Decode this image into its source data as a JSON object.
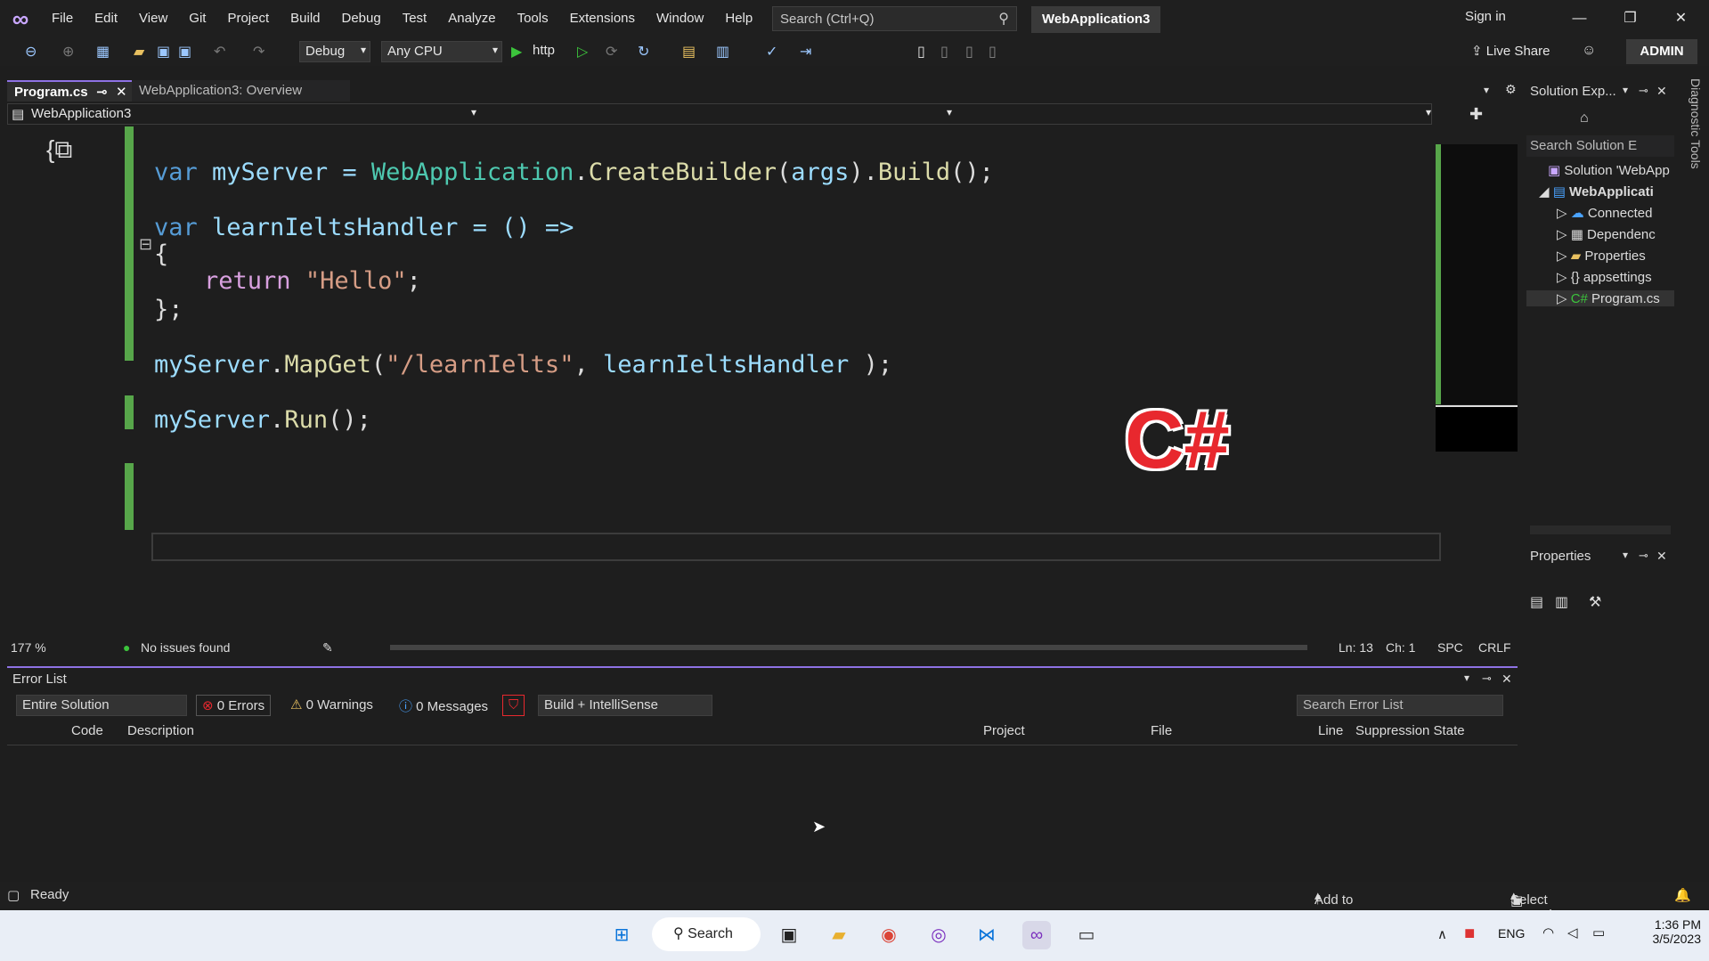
{
  "menu": [
    "File",
    "Edit",
    "View",
    "Git",
    "Project",
    "Build",
    "Debug",
    "Test",
    "Analyze",
    "Tools",
    "Extensions",
    "Window",
    "Help"
  ],
  "search_placeholder": "Search (Ctrl+Q)",
  "solution_name": "WebApplication3",
  "sign_in": "Sign in",
  "toolbar": {
    "config": "Debug",
    "platform": "Any CPU",
    "run_target": "http",
    "live_share": "Live Share",
    "admin": "ADMIN"
  },
  "tabs": [
    {
      "label": "Program.cs"
    },
    {
      "label": "WebApplication3: Overview"
    }
  ],
  "nav": {
    "project": "WebApplication3"
  },
  "code": {
    "l1": {
      "kw": "var",
      "name": " myServer = ",
      "type": "WebApplication",
      ".": ".",
      "fn": "CreateBuilder",
      "p1": "(",
      "arg": "args",
      "p2": ").",
      "fn2": "Build",
      "end": "();"
    },
    "l2": {
      "kw": "var",
      "name": " learnIeltsHandler = () =>"
    },
    "l3": "{",
    "l4": {
      "kw": "return",
      "str": "\"Hello\"",
      "end": ";"
    },
    "l5": "};",
    "l6": {
      "obj": "myServer",
      ".": ".",
      "fn": "MapGet",
      "p": "(",
      "str": "\"/learnIelts\"",
      "mid": ", ",
      "arg": "learnIeltsHandler",
      "end": " );"
    },
    "l7": {
      "obj": "myServer",
      ".": ".",
      "fn": "Run",
      "end": "();"
    }
  },
  "overlay": "C#",
  "status": {
    "zoom": "177 %",
    "issues": "No issues found",
    "ln": "Ln: 13",
    "ch": "Ch: 1",
    "spc": "SPC",
    "crlf": "CRLF"
  },
  "errors": {
    "title": "Error List",
    "scope": "Entire Solution",
    "errors": "0 Errors",
    "warnings": "0 Warnings",
    "messages": "0 Messages",
    "filter": "Build + IntelliSense",
    "search": "Search Error List",
    "columns": [
      "Code",
      "Description",
      "Project",
      "File",
      "Line",
      "Suppression State"
    ]
  },
  "solution": {
    "title": "Solution Exp...",
    "search": "Search Solution E",
    "items": [
      "Solution 'WebApp",
      "WebApplicati",
      "Connected",
      "Dependenc",
      "Properties",
      "appsettings",
      "Program.cs"
    ]
  },
  "properties": {
    "title": "Properties"
  },
  "diagnostic": "Diagnostic Tools",
  "statusbar": {
    "ready": "Ready",
    "source": "Add to Source Control",
    "repo": "Select Repository"
  },
  "taskbar": {
    "search": "Search",
    "lang": "ENG",
    "time": "1:36 PM",
    "date": "3/5/2023"
  }
}
